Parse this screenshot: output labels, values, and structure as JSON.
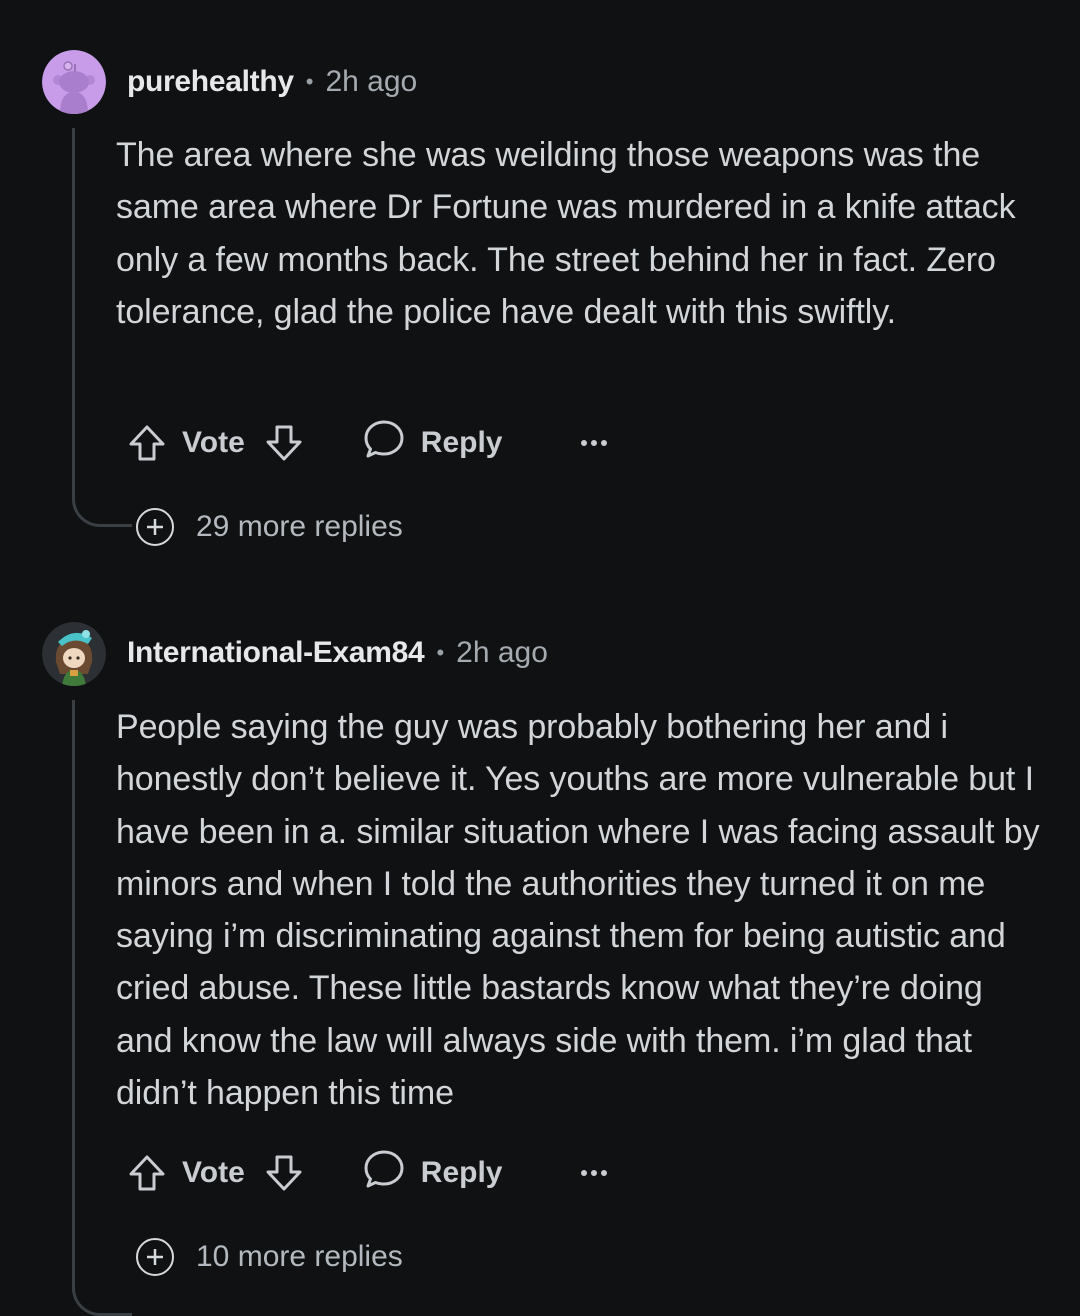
{
  "comments": [
    {
      "username": "purehealthy",
      "separator": "•",
      "time": "2h ago",
      "text": "The area where she was weilding those weapons was the same area where Dr Fortune was murdered in a knife attack only a few months back. The street behind her in fact. Zero tolerance, glad the police have dealt with this swiftly.",
      "vote_label": "Vote",
      "reply_label": "Reply",
      "more_replies": "29 more replies",
      "avatar_icon": "snoo-avatar-icon",
      "avatar_color": "#c89ce8"
    },
    {
      "username": "International-Exam84",
      "separator": "•",
      "time": "2h ago",
      "text": "People saying the guy was probably bothering her and i honestly don’t believe it. Yes youths are more vulnerable but I have been in a. similar situation where I was facing assault by minors and when I told the authorities they turned it on me saying i’m discriminating against them for being autistic and cried abuse. These little bastards know what they’re doing and know the law will always side with them. i’m glad that didn’t happen this time",
      "vote_label": "Vote",
      "reply_label": "Reply",
      "more_replies": "10 more replies",
      "avatar_icon": "character-avatar-icon",
      "avatar_color": "#2c2f33"
    }
  ],
  "colors": {
    "background": "#0f1113",
    "text": "#d3d6d9",
    "muted": "#a4aaaf",
    "thread_line": "#3a3f44"
  }
}
